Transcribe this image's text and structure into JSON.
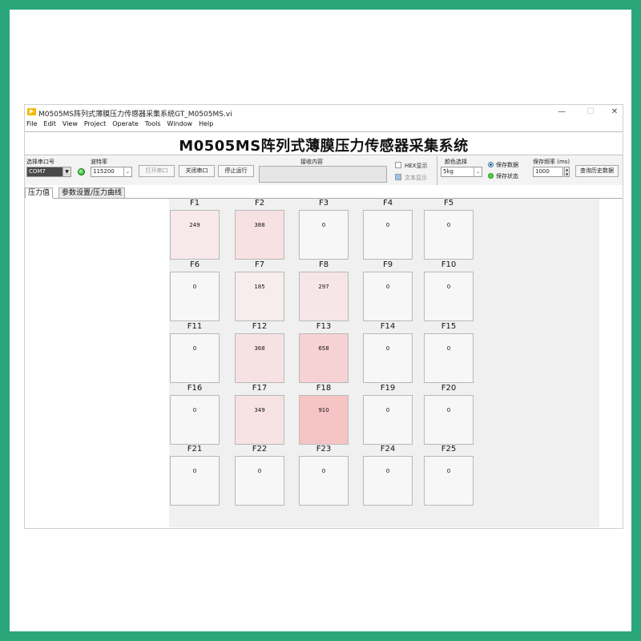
{
  "window": {
    "title": "M0505MS阵列式薄膜压力传感器采集系统GT_M0505MS.vi",
    "minimize": "—",
    "maximize": "☐",
    "close": "✕"
  },
  "menu": [
    "File",
    "Edit",
    "View",
    "Project",
    "Operate",
    "Tools",
    "Window",
    "Help"
  ],
  "header": {
    "title": "M0505MS阵列式薄膜压力传感器采集系统"
  },
  "controls": {
    "port_label": "选择串口号",
    "port_value": "COM7",
    "baud_label": "波特率",
    "baud_value": "115200",
    "open_port": "打开串口",
    "close_port": "关闭串口",
    "stop_run": "停止运行",
    "receive_label": "接收内容",
    "hex_display": "HEX显示",
    "text_display": "文本显示",
    "color_label": "颜色选择",
    "color_value": "5kg",
    "save_data": "保存数据",
    "save_status": "保存状态",
    "save_freq_label": "保存频率 (ms)",
    "save_freq_value": "1000",
    "query_history": "查询历史数据"
  },
  "tabs": [
    "压力值",
    "参数设置/压力曲线"
  ],
  "grid": {
    "cells": [
      {
        "label": "F1",
        "value": 249
      },
      {
        "label": "F2",
        "value": 388
      },
      {
        "label": "F3",
        "value": 0
      },
      {
        "label": "F4",
        "value": 0
      },
      {
        "label": "F5",
        "value": 0
      },
      {
        "label": "F6",
        "value": 0
      },
      {
        "label": "F7",
        "value": 185
      },
      {
        "label": "F8",
        "value": 297
      },
      {
        "label": "F9",
        "value": 0
      },
      {
        "label": "F10",
        "value": 0
      },
      {
        "label": "F11",
        "value": 0
      },
      {
        "label": "F12",
        "value": 368
      },
      {
        "label": "F13",
        "value": 658
      },
      {
        "label": "F14",
        "value": 0
      },
      {
        "label": "F15",
        "value": 0
      },
      {
        "label": "F16",
        "value": 0
      },
      {
        "label": "F17",
        "value": 349
      },
      {
        "label": "F18",
        "value": 910
      },
      {
        "label": "F19",
        "value": 0
      },
      {
        "label": "F20",
        "value": 0
      },
      {
        "label": "F21",
        "value": 0
      },
      {
        "label": "F22",
        "value": 0
      },
      {
        "label": "F23",
        "value": 0
      },
      {
        "label": "F24",
        "value": 0
      },
      {
        "label": "F25",
        "value": 0
      }
    ]
  },
  "colors": {
    "frame_border": "#2aa67a",
    "cell_zero": "#f7f7f7",
    "cell_max": "#f7c4c6",
    "led_green": "#22aa22"
  }
}
